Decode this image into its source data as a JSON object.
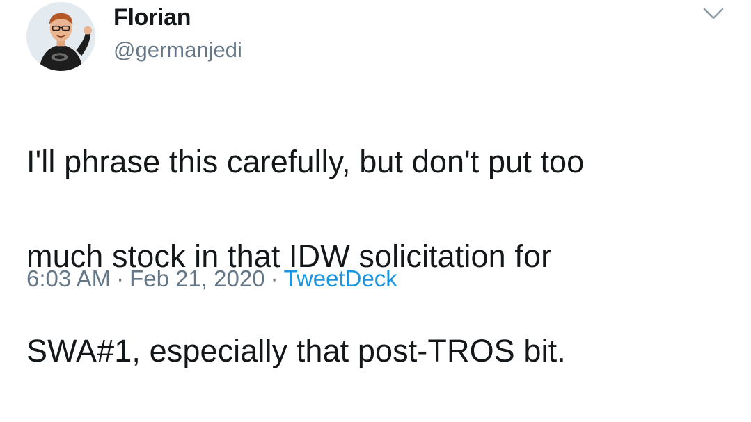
{
  "author": {
    "display_name": "Florian",
    "handle": "@germanjedi",
    "avatar_icon": "avatar-cartoon-person"
  },
  "menu": {
    "icon": "chevron-down-icon"
  },
  "tweet": {
    "text_lines": [
      "I'll phrase this carefully, but don't put too",
      "much stock in that IDW solicitation for",
      "SWA#1, especially that post-TROS bit."
    ],
    "time": "6:03 AM",
    "date": "Feb 21, 2020",
    "separator": "·",
    "source": "TweetDeck"
  },
  "colors": {
    "text": "#14171a",
    "secondary": "#657786",
    "link": "#1b95e0"
  }
}
